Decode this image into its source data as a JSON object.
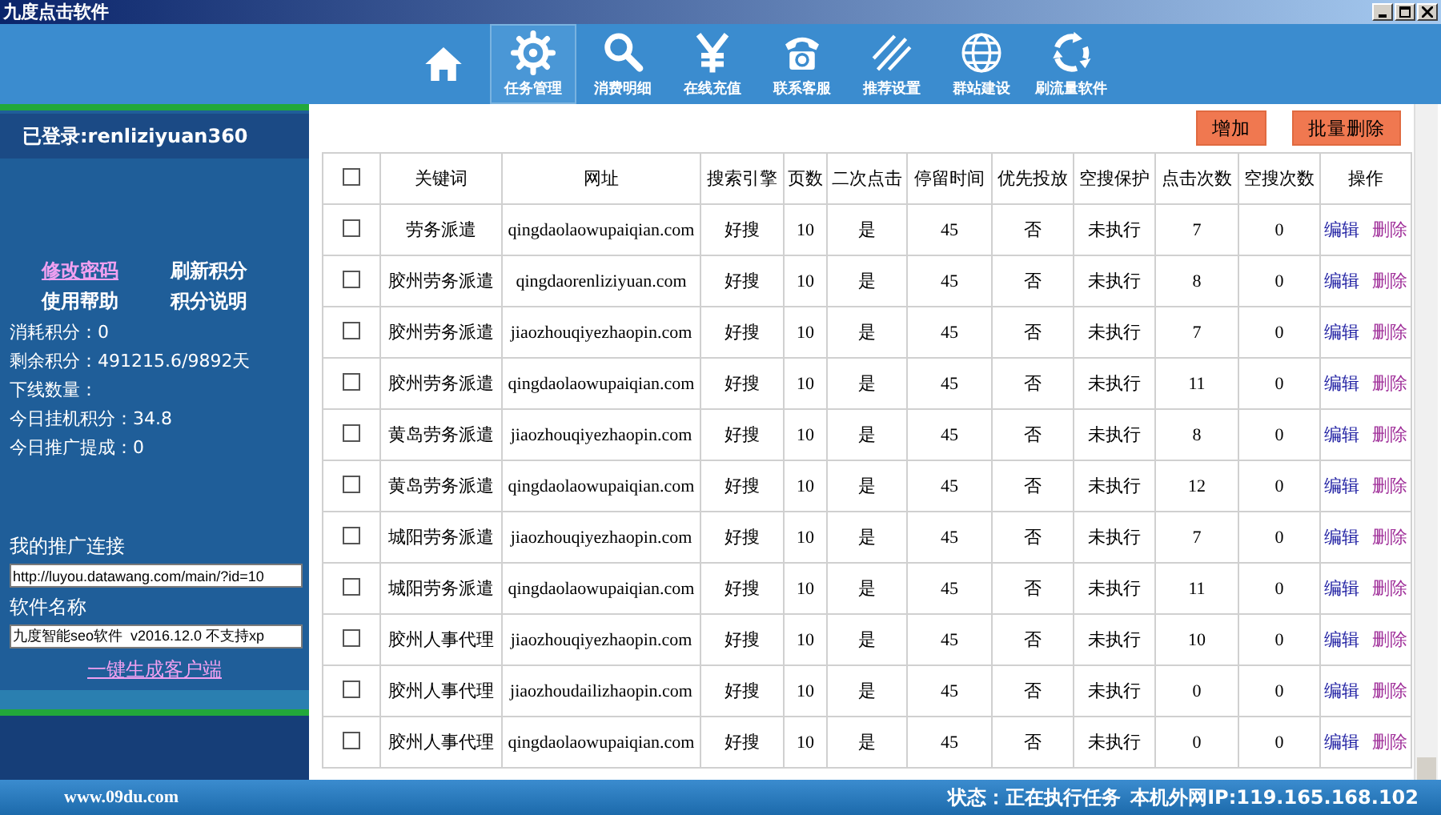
{
  "window": {
    "title": "九度点击软件"
  },
  "toolbar": [
    {
      "selected": false
    },
    {
      "label": "任务管理",
      "selected": true
    },
    {
      "label": "消费明细",
      "selected": false
    },
    {
      "label": "在线充值",
      "selected": false
    },
    {
      "label": "联系客服",
      "selected": false
    },
    {
      "label": "推荐设置",
      "selected": false
    },
    {
      "label": "群站建设",
      "selected": false
    },
    {
      "label": "刷流量软件",
      "selected": false
    }
  ],
  "sidebar": {
    "login": "已登录:renliziyuan360",
    "links": [
      "修改密码",
      "刷新积分",
      "使用帮助",
      "积分说明"
    ],
    "stats": [
      "消耗积分：0",
      "剩余积分：491215.6/9892天",
      "下线数量：",
      "今日挂机积分：34.8",
      "今日推广提成：0"
    ],
    "promo_label": "我的推广连接",
    "promo_value": "http://luyou.datawang.com/main/?id=10",
    "name_label": "软件名称",
    "name_value": "九度智能seo软件  v2016.12.0 不支持xp",
    "generate_link": "一键生成客户端"
  },
  "actions": [
    "增加",
    "批量删除"
  ],
  "table": {
    "header_checked": false,
    "columns": [
      "关键词",
      "网址",
      "搜索引擎",
      "页数",
      "二次点击",
      "停留时间",
      "优先投放",
      "空搜保护",
      "点击次数",
      "空搜次数",
      "操作"
    ],
    "rows": [
      {
        "checked": false,
        "cells": [
          "劳务派遣",
          "qingdaolaowupaiqian.com",
          "好搜",
          "10",
          "是",
          "45",
          "否",
          "未执行",
          "7",
          "0"
        ],
        "edit": "编辑",
        "delete": "删除"
      },
      {
        "checked": false,
        "cells": [
          "胶州劳务派遣",
          "qingdaorenliziyuan.com",
          "好搜",
          "10",
          "是",
          "45",
          "否",
          "未执行",
          "8",
          "0"
        ],
        "edit": "编辑",
        "delete": "删除"
      },
      {
        "checked": false,
        "cells": [
          "胶州劳务派遣",
          "jiaozhouqiyezhaopin.com",
          "好搜",
          "10",
          "是",
          "45",
          "否",
          "未执行",
          "7",
          "0"
        ],
        "edit": "编辑",
        "delete": "删除"
      },
      {
        "checked": false,
        "cells": [
          "胶州劳务派遣",
          "qingdaolaowupaiqian.com",
          "好搜",
          "10",
          "是",
          "45",
          "否",
          "未执行",
          "11",
          "0"
        ],
        "edit": "编辑",
        "delete": "删除"
      },
      {
        "checked": false,
        "cells": [
          "黄岛劳务派遣",
          "jiaozhouqiyezhaopin.com",
          "好搜",
          "10",
          "是",
          "45",
          "否",
          "未执行",
          "8",
          "0"
        ],
        "edit": "编辑",
        "delete": "删除"
      },
      {
        "checked": false,
        "cells": [
          "黄岛劳务派遣",
          "qingdaolaowupaiqian.com",
          "好搜",
          "10",
          "是",
          "45",
          "否",
          "未执行",
          "12",
          "0"
        ],
        "edit": "编辑",
        "delete": "删除"
      },
      {
        "checked": false,
        "cells": [
          "城阳劳务派遣",
          "jiaozhouqiyezhaopin.com",
          "好搜",
          "10",
          "是",
          "45",
          "否",
          "未执行",
          "7",
          "0"
        ],
        "edit": "编辑",
        "delete": "删除"
      },
      {
        "checked": false,
        "cells": [
          "城阳劳务派遣",
          "qingdaolaowupaiqian.com",
          "好搜",
          "10",
          "是",
          "45",
          "否",
          "未执行",
          "11",
          "0"
        ],
        "edit": "编辑",
        "delete": "删除"
      },
      {
        "checked": false,
        "cells": [
          "胶州人事代理",
          "jiaozhouqiyezhaopin.com",
          "好搜",
          "10",
          "是",
          "45",
          "否",
          "未执行",
          "10",
          "0"
        ],
        "edit": "编辑",
        "delete": "删除"
      },
      {
        "checked": false,
        "cells": [
          "胶州人事代理",
          "jiaozhoudailizhaopin.com",
          "好搜",
          "10",
          "是",
          "45",
          "否",
          "未执行",
          "0",
          "0"
        ],
        "edit": "编辑",
        "delete": "删除"
      },
      {
        "checked": false,
        "cells": [
          "胶州人事代理",
          "qingdaolaowupaiqian.com",
          "好搜",
          "10",
          "是",
          "45",
          "否",
          "未执行",
          "0",
          "0"
        ],
        "edit": "编辑",
        "delete": "删除"
      }
    ]
  },
  "status_bar": {
    "site": "www.09du.com",
    "status": "状态：正在执行任务",
    "ip": "本机外网IP:119.165.168.102"
  }
}
